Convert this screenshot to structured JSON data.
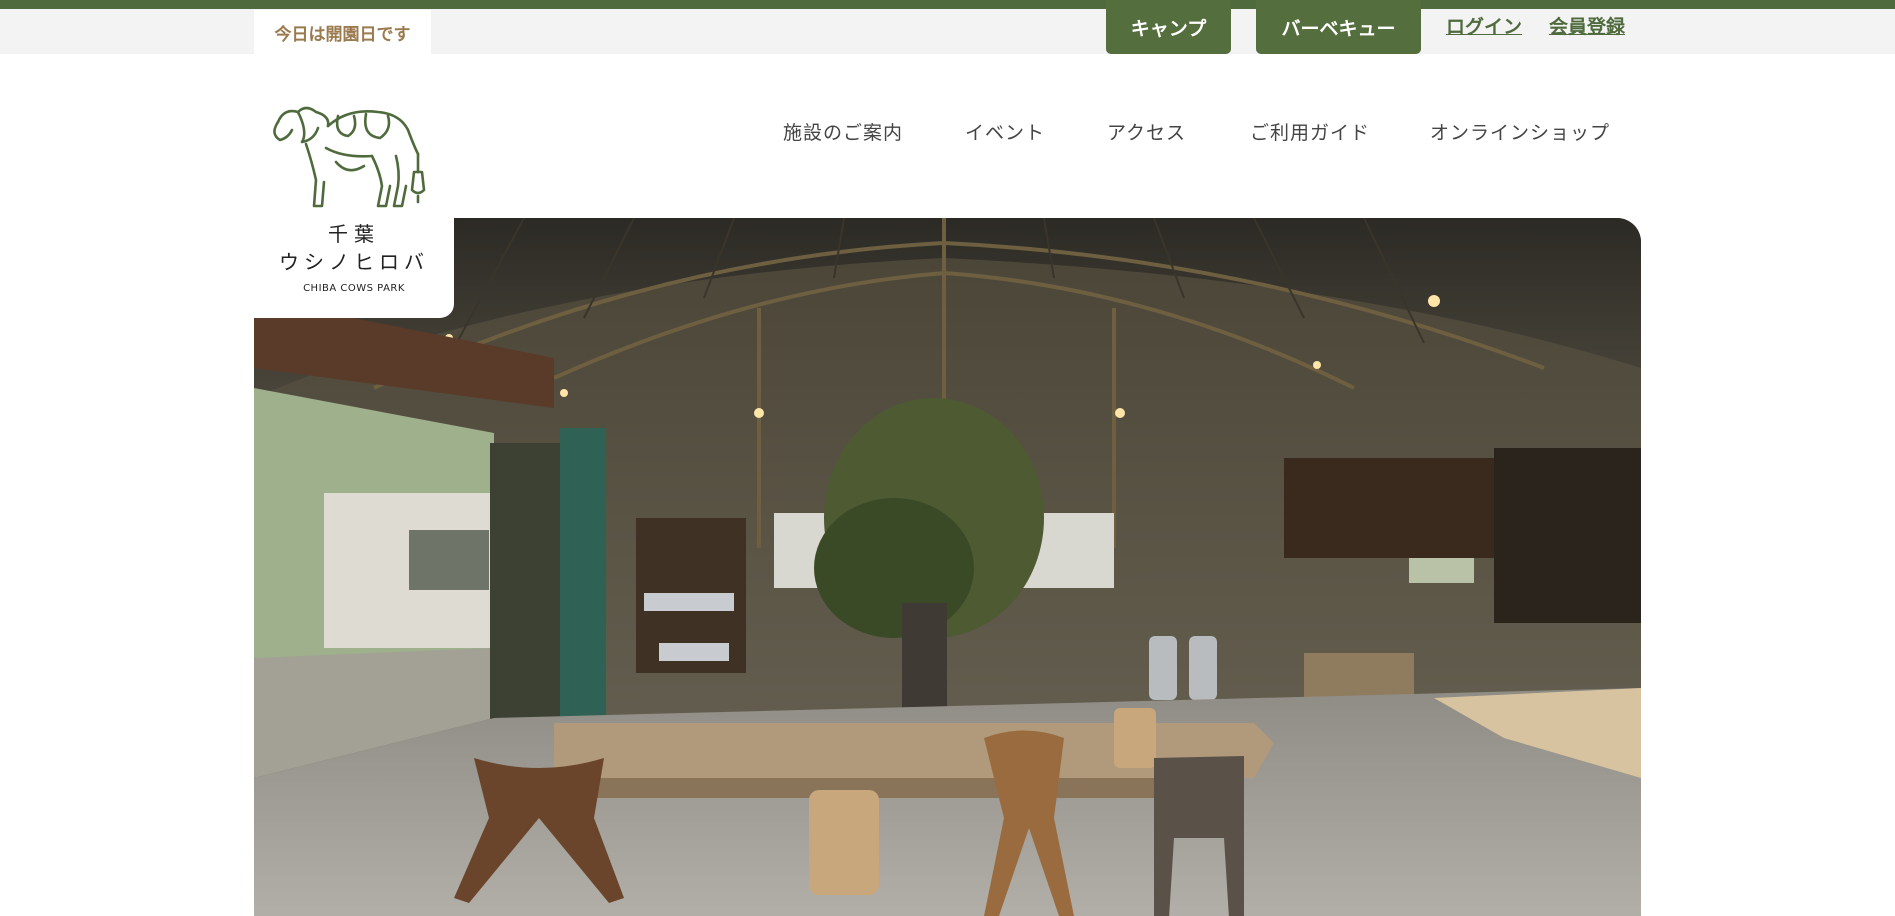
{
  "utility_bar": {
    "status": "今日は開園日です",
    "camp_label": "キャンプ",
    "bbq_label": "バーベキュー",
    "login_label": "ログイン",
    "register_label": "会員登録"
  },
  "logo": {
    "name_line1": "千葉",
    "name_line2": "ウシノヒロバ",
    "name_en": "CHIBA COWS PARK",
    "icon": "cow-line-icon"
  },
  "nav": {
    "items": [
      {
        "label": "施設のご案内"
      },
      {
        "label": "イベント"
      },
      {
        "label": "アクセス"
      },
      {
        "label": "ご利用ガイド"
      },
      {
        "label": "オンラインショップ"
      }
    ]
  },
  "colors": {
    "brand_green": "#546e3e",
    "status_brown": "#9a7a4e",
    "utility_bg": "#f3f3f3"
  }
}
